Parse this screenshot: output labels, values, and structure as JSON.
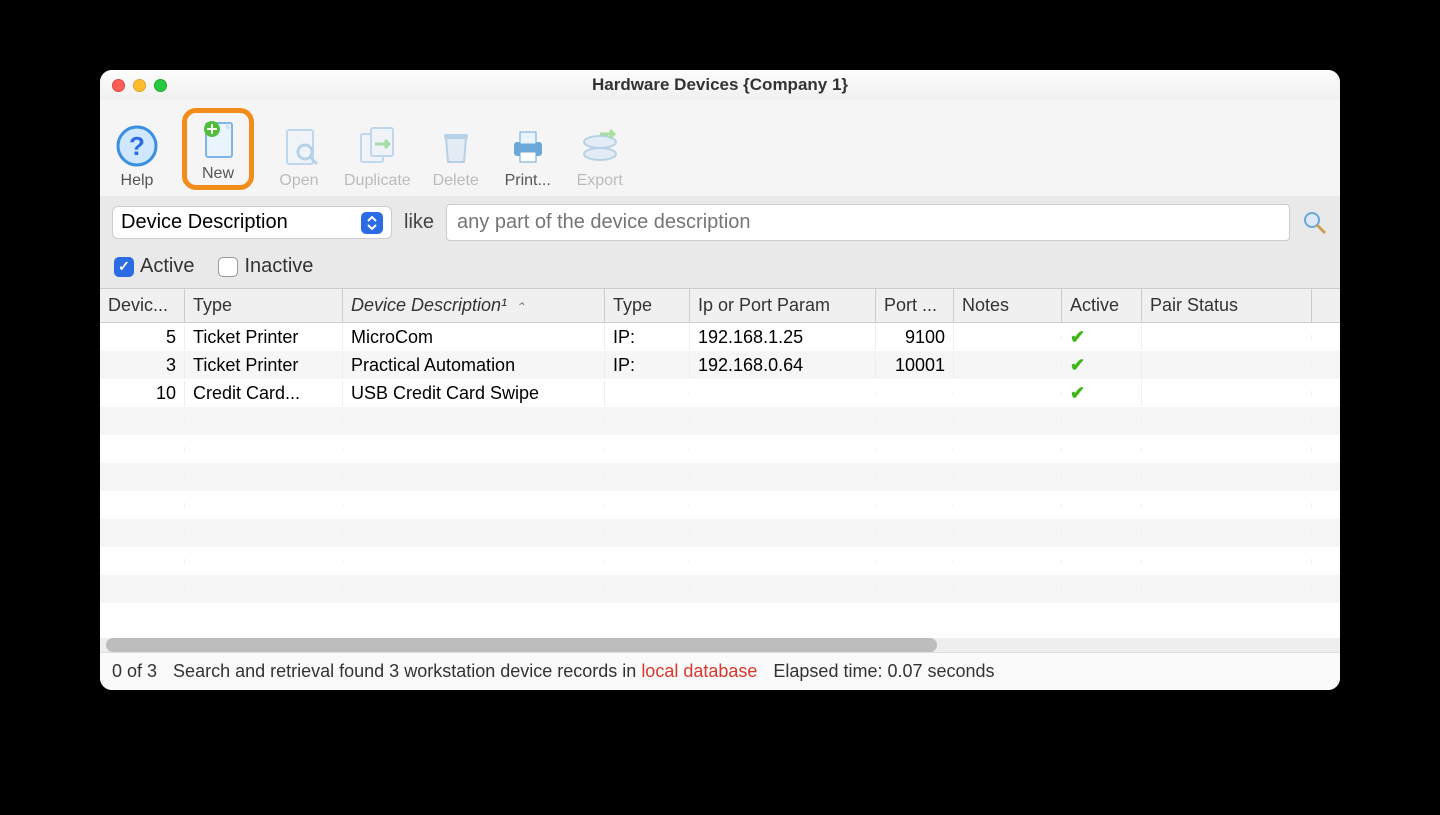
{
  "window": {
    "title": "Hardware Devices {Company 1}"
  },
  "toolbar": {
    "help": {
      "label": "Help",
      "enabled": true
    },
    "new": {
      "label": "New",
      "enabled": true,
      "highlighted": true
    },
    "open": {
      "label": "Open",
      "enabled": false
    },
    "duplicate": {
      "label": "Duplicate",
      "enabled": false
    },
    "delete": {
      "label": "Delete",
      "enabled": false
    },
    "print": {
      "label": "Print...",
      "enabled": true
    },
    "export": {
      "label": "Export",
      "enabled": false
    }
  },
  "filter": {
    "field_selector": "Device Description",
    "operator": "like",
    "search_placeholder": "any part of the device description"
  },
  "status_filters": {
    "active": {
      "label": "Active",
      "checked": true
    },
    "inactive": {
      "label": "Inactive",
      "checked": false
    }
  },
  "columns": [
    {
      "label": "Devic..."
    },
    {
      "label": "Type"
    },
    {
      "label": "Device Description¹",
      "sorted": true
    },
    {
      "label": "Type"
    },
    {
      "label": "Ip or Port Param"
    },
    {
      "label": "Port ..."
    },
    {
      "label": "Notes"
    },
    {
      "label": "Active"
    },
    {
      "label": "Pair Status"
    }
  ],
  "rows": [
    {
      "id": "5",
      "type1": "Ticket Printer",
      "desc": "MicroCom",
      "type2": "IP:",
      "ip": "192.168.1.25",
      "port": "9100",
      "notes": "",
      "active": true,
      "pair": ""
    },
    {
      "id": "3",
      "type1": "Ticket Printer",
      "desc": "Practical Automation",
      "type2": "IP:",
      "ip": "192.168.0.64",
      "port": "10001",
      "notes": "",
      "active": true,
      "pair": ""
    },
    {
      "id": "10",
      "type1": "Credit Card...",
      "desc": "USB Credit Card Swipe",
      "type2": "",
      "ip": "",
      "port": "",
      "notes": "",
      "active": true,
      "pair": ""
    }
  ],
  "statusbar": {
    "count": "0 of 3",
    "msg_pre": "Search and retrieval found 3 workstation device records in",
    "msg_source": "local database",
    "elapsed": "Elapsed time: 0.07 seconds"
  }
}
